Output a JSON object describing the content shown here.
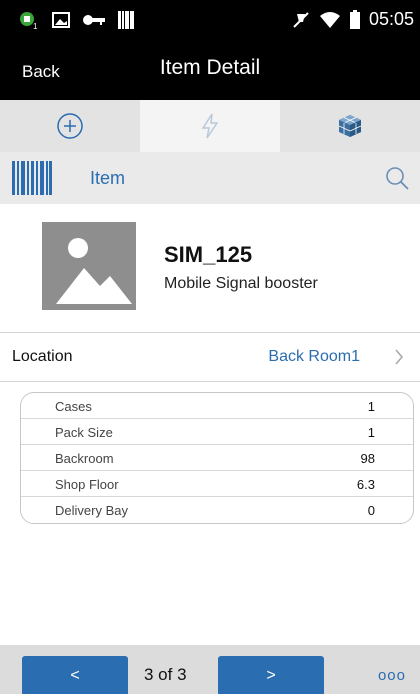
{
  "status_bar": {
    "time": "05:05",
    "icons": [
      "notification-icon",
      "image-icon",
      "key-icon",
      "barcode-icon",
      "silent-icon",
      "wifi-icon",
      "battery-icon"
    ]
  },
  "app_bar": {
    "back_label": "Back",
    "title": "Item Detail"
  },
  "tabs": [
    {
      "icon": "add-circle-icon",
      "active": false
    },
    {
      "icon": "lightning-icon",
      "active": true
    },
    {
      "icon": "cube-icon",
      "active": false
    }
  ],
  "item_bar": {
    "label": "Item",
    "icons": [
      "barcode-scan-icon",
      "search-icon"
    ]
  },
  "item": {
    "sku": "SIM_125",
    "description": "Mobile Signal booster",
    "image_icon": "image-placeholder-icon"
  },
  "location": {
    "label": "Location",
    "value": "Back Room1"
  },
  "details": [
    {
      "label": "Cases",
      "value": "1"
    },
    {
      "label": "Pack Size",
      "value": "1"
    },
    {
      "label": "Backroom",
      "value": "98"
    },
    {
      "label": "Shop Floor",
      "value": "6.3"
    },
    {
      "label": "Delivery Bay",
      "value": "0"
    }
  ],
  "pagination": {
    "prev_label": "<",
    "page_text": "3 of 3",
    "next_label": ">",
    "more_label": "ooo"
  },
  "colors": {
    "accent": "#2a6db0",
    "header_bg": "#000000",
    "tab_bg": "#e3e3e3"
  }
}
